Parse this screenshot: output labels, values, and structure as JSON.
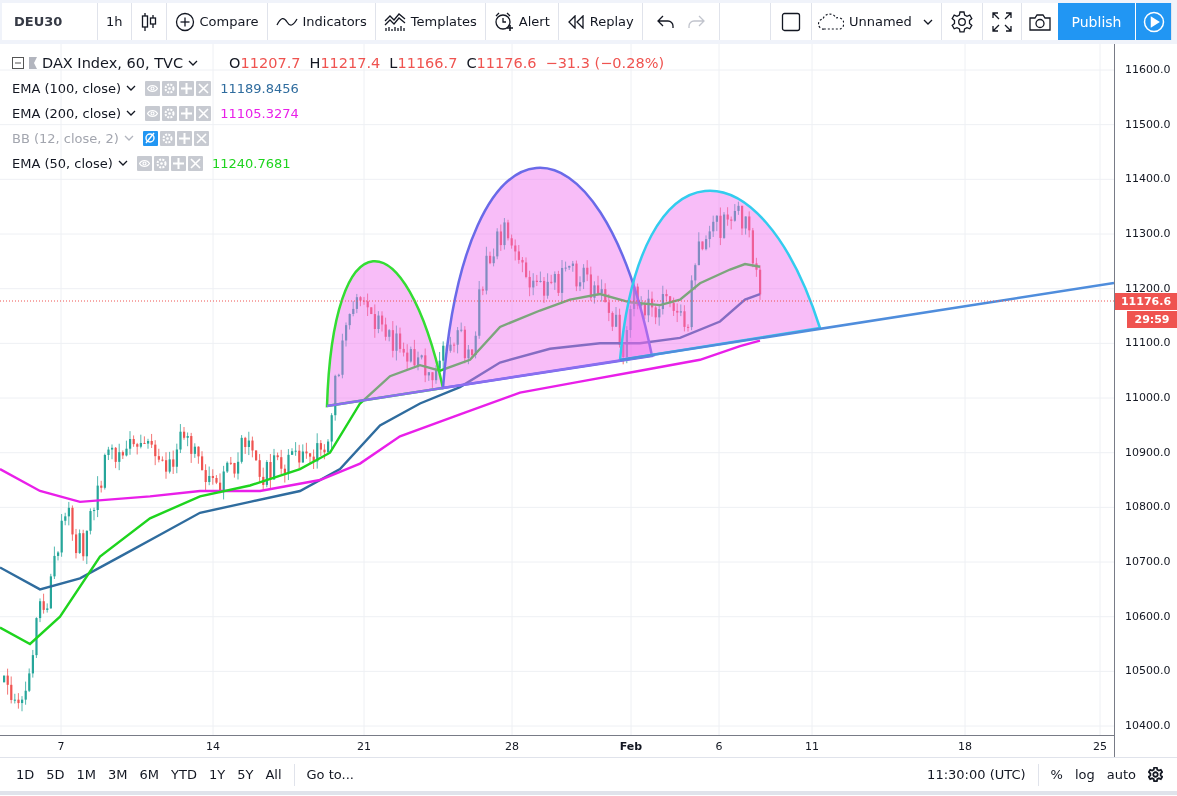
{
  "toolbar": {
    "symbol": "DEU30",
    "interval": "1h",
    "buttons": [
      {
        "kind": "compare",
        "label": "Compare"
      },
      {
        "kind": "indicators",
        "label": "Indicators"
      },
      {
        "kind": "templates",
        "label": "Templates"
      },
      {
        "kind": "alert",
        "label": "Alert"
      },
      {
        "kind": "replay",
        "label": "Replay"
      }
    ],
    "undo": {
      "disabled": false
    },
    "redo": {
      "disabled": true
    },
    "layout_name": "Unnamed",
    "publish": "Publish"
  },
  "legend": {
    "title": "DAX Index, 60, TVC",
    "ohlc": [
      {
        "label": "O",
        "value": "11207.7"
      },
      {
        "label": "H",
        "value": "11217.4"
      },
      {
        "label": "L",
        "value": "11166.7"
      },
      {
        "label": "C",
        "value": "11176.6"
      }
    ],
    "change": "−31.3 (−0.28%)",
    "indicators": [
      {
        "name": "EMA (100, close)",
        "hidden": false,
        "value": "11189.8456",
        "color": "#2f6c9e"
      },
      {
        "name": "EMA (200, close)",
        "hidden": false,
        "value": "11105.3274",
        "color": "#e91fe9"
      },
      {
        "name": "BB (12, close, 2)",
        "hidden": true
      },
      {
        "name": "EMA (50, close)",
        "hidden": false,
        "value": "11240.7681",
        "color": "#1ed41e"
      }
    ]
  },
  "price_axis": {
    "ticks": [
      "11600.0",
      "11500.0",
      "11400.0",
      "11300.0",
      "11200.0",
      "11100.0",
      "11000.0",
      "10900.0",
      "10800.0",
      "10700.0",
      "10600.0",
      "10500.0",
      "10400.0"
    ],
    "last_price": "11176.6",
    "countdown": "29:59"
  },
  "time_axis": {
    "ticks": [
      {
        "label": "7",
        "major": false
      },
      {
        "label": "14",
        "major": false
      },
      {
        "label": "21",
        "major": false
      },
      {
        "label": "28",
        "major": false
      },
      {
        "label": "Feb",
        "major": true
      },
      {
        "label": "6",
        "major": false
      },
      {
        "label": "11",
        "major": false
      },
      {
        "label": "18",
        "major": false
      },
      {
        "label": "25",
        "major": false
      }
    ]
  },
  "bottom_bar": {
    "ranges": [
      "1D",
      "5D",
      "1M",
      "3M",
      "6M",
      "YTD",
      "1Y",
      "5Y",
      "All"
    ],
    "goto": "Go to...",
    "time": "11:30:00 (UTC)",
    "percent": "%",
    "log": "log",
    "auto": "auto"
  }
}
